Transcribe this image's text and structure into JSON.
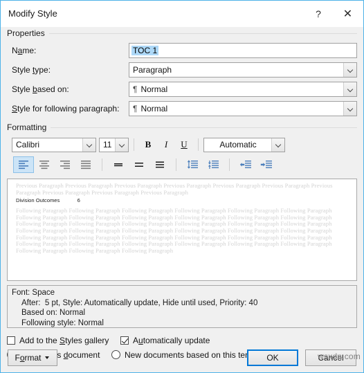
{
  "window": {
    "title": "Modify Style",
    "help_button": "?",
    "close_button": "✕"
  },
  "properties": {
    "group_label": "Properties",
    "name": {
      "label_pre": "N",
      "label_accel": "a",
      "label_post": "me:",
      "value": "TOC 1"
    },
    "style_type": {
      "label_pre": "Style ",
      "label_accel": "t",
      "label_post": "ype:",
      "value": "Paragraph"
    },
    "style_based_on": {
      "label_pre": "Style ",
      "label_accel": "b",
      "label_post": "ased on:",
      "glyph": "¶",
      "value": "Normal"
    },
    "style_following": {
      "label_pre": "",
      "label_accel": "S",
      "label_post": "tyle for following paragraph:",
      "glyph": "¶",
      "value": "Normal"
    }
  },
  "formatting": {
    "group_label": "Formatting",
    "font_family": "Calibri",
    "font_size": "11",
    "bold": "B",
    "italic": "I",
    "underline": "U",
    "font_color": "Automatic",
    "align_active_index": 0,
    "align_buttons": [
      "align-left",
      "align-center",
      "align-right",
      "align-justify"
    ],
    "spacing_buttons": [
      "line-spacing-single",
      "line-spacing-1-5",
      "line-spacing-double"
    ],
    "space_buttons": [
      "increase-space-before",
      "decrease-space-after"
    ],
    "indent_buttons": [
      "decrease-indent",
      "increase-indent"
    ]
  },
  "preview": {
    "previous_paragraph": "Previous Paragraph Previous Paragraph Previous Paragraph Previous Paragraph Previous Paragraph Previous Paragraph Previous Paragraph Previous Paragraph Previous Paragraph Previous Paragraph",
    "sample_text": "Division Outcomes            6",
    "following_paragraph": "Following Paragraph Following Paragraph Following Paragraph Following Paragraph Following Paragraph Following Paragraph Following Paragraph Following Paragraph Following Paragraph Following Paragraph Following Paragraph Following Paragraph Following Paragraph Following Paragraph Following Paragraph Following Paragraph Following Paragraph Following Paragraph Following Paragraph Following Paragraph Following Paragraph Following Paragraph Following Paragraph Following Paragraph Following Paragraph Following Paragraph Following Paragraph Following Paragraph Following Paragraph Following Paragraph Following Paragraph Following Paragraph Following Paragraph Following Paragraph Following Paragraph Following Paragraph Following Paragraph Following Paragraph Following Paragraph"
  },
  "description": {
    "line1": "Font: Space",
    "line2": "After:  5 pt, Style: Automatically update, Hide until used, Priority: 40",
    "line3": "Based on: Normal",
    "line4": "Following style: Normal"
  },
  "options": {
    "add_gallery": {
      "label_pre": "Add to the ",
      "label_accel": "S",
      "label_post": "tyles gallery",
      "checked": false
    },
    "auto_update": {
      "label_pre": "A",
      "label_accel": "u",
      "label_post": "tomatically update",
      "checked": true
    },
    "only_this_doc": {
      "label_pre": "Only in this ",
      "label_accel": "d",
      "label_post": "ocument",
      "selected": true
    },
    "new_docs": {
      "label_pre": "New documents based on this template",
      "label_accel": "",
      "label_post": "",
      "selected": false
    }
  },
  "footer": {
    "format_pre": "F",
    "format_accel": "o",
    "format_post": "rmat",
    "ok": "OK",
    "cancel": "Cancel"
  },
  "watermark": "wsxdn.com",
  "colors": {
    "window_border": "#4db2e8",
    "dialog_bg": "#f0f0f0",
    "focus_blue": "#0078d7",
    "selection_blue": "#add8f7",
    "toolbar_active": "#cce4f7",
    "icon_blue": "#4a7ebb",
    "ghost_text": "#d3d3d3"
  }
}
